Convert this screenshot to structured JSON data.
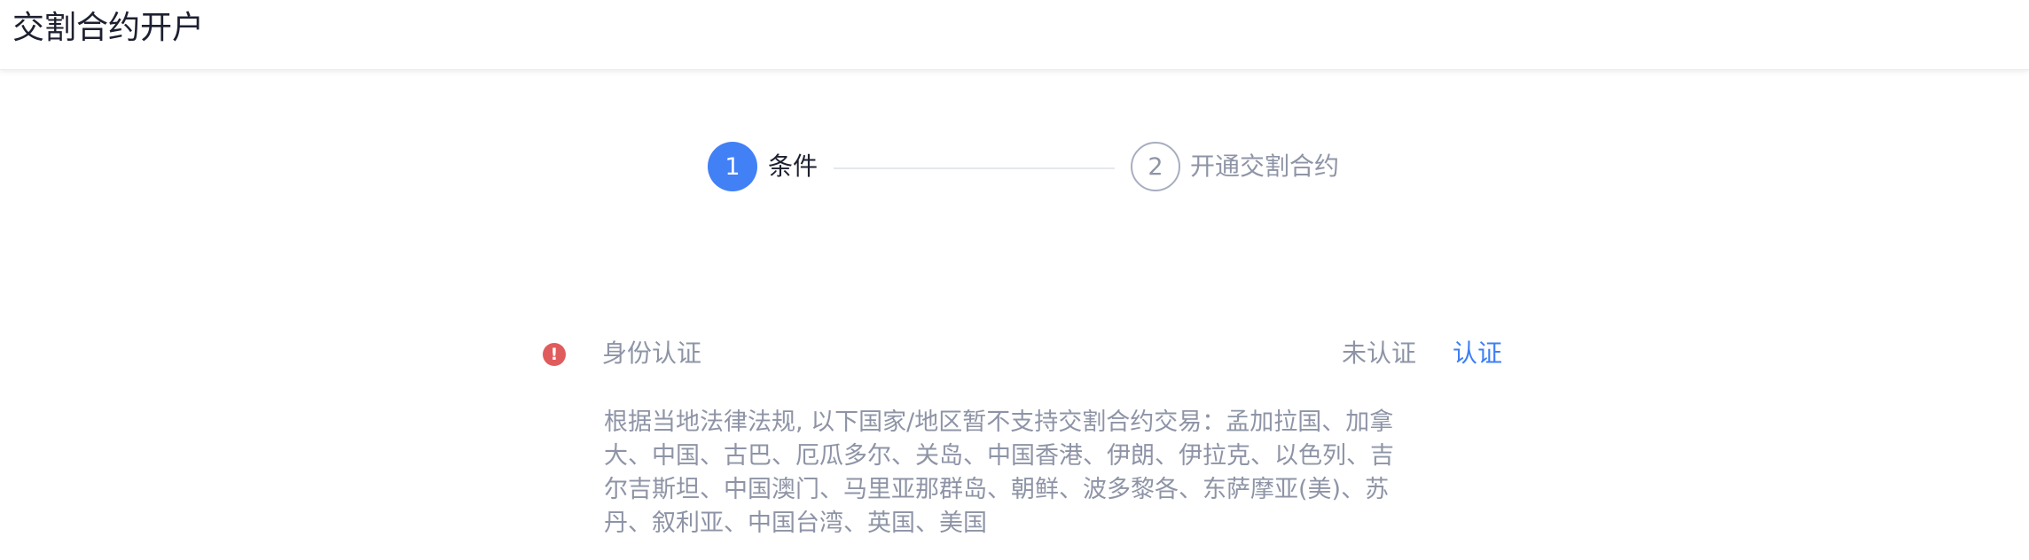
{
  "header": {
    "title": "交割合约开户"
  },
  "steps": [
    {
      "number": "1",
      "label": "条件",
      "status": "active"
    },
    {
      "number": "2",
      "label": "开通交割合约",
      "status": "inactive"
    }
  ],
  "requirement": {
    "icon": "alert-icon",
    "title": "身份认证",
    "status": "未认证",
    "action_label": "认证",
    "note": "根据当地法律法规, 以下国家/地区暂不支持交割合约交易：孟加拉国、加拿大、中国、古巴、厄瓜多尔、关岛、中国香港、伊朗、伊拉克、以色列、吉尔吉斯坦、中国澳门、马里亚那群岛、朝鲜、波多黎各、东萨摩亚(美)、苏丹、叙利亚、中国台湾、英国、美国"
  },
  "colors": {
    "accent": "#4280f5",
    "link": "#3f7ef5",
    "alert": "#e05c5c",
    "muted_text": "#8e94a6",
    "primary_text": "#1d2030"
  }
}
